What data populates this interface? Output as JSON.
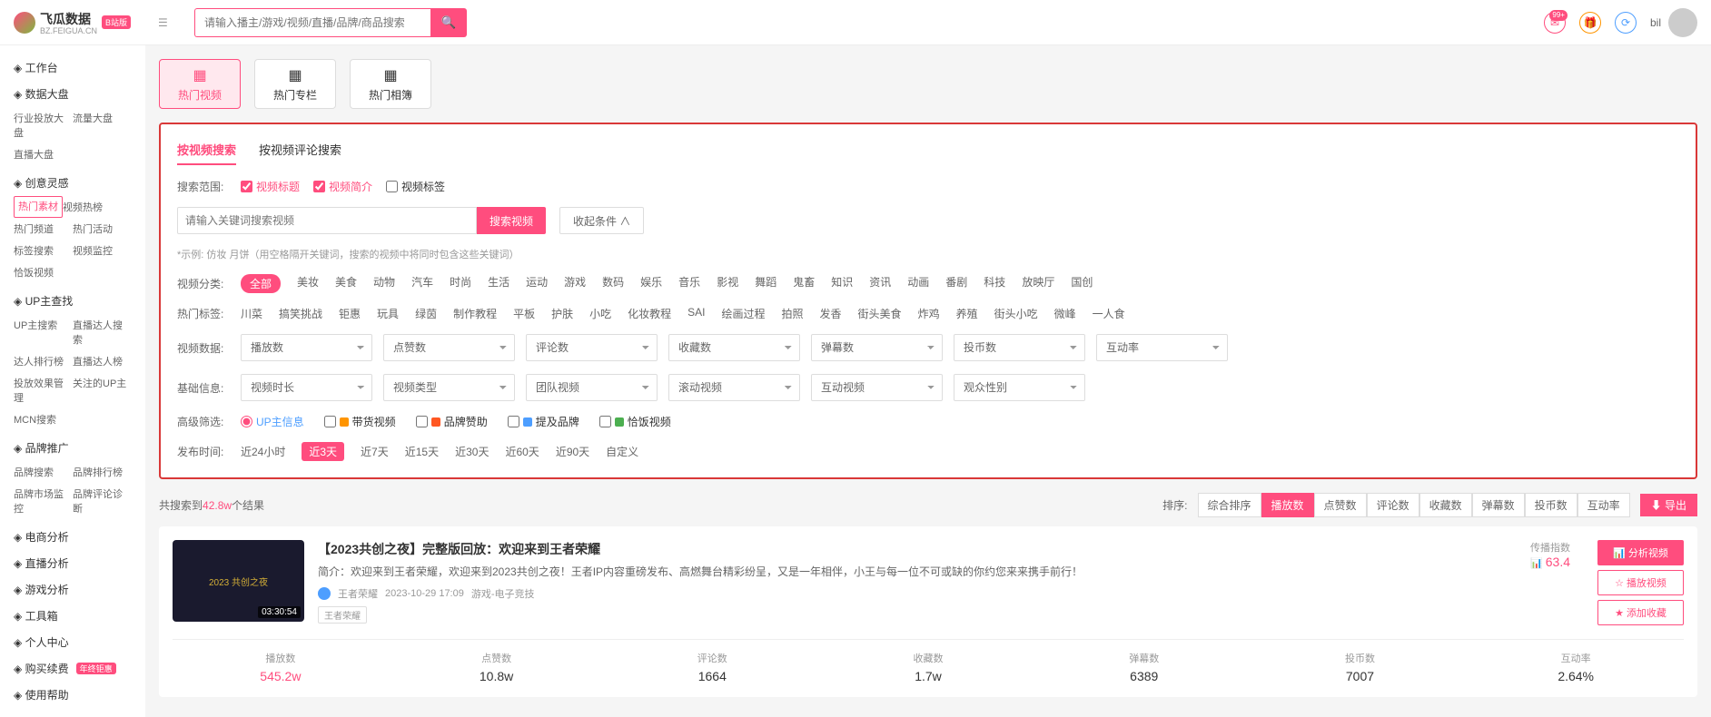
{
  "header": {
    "logo_name": "飞瓜数据",
    "logo_sub": "BZ.FEIGUA.CN",
    "logo_badge": "B站版",
    "search_placeholder": "请输入播主/游戏/视频/直播/品牌/商品搜索",
    "notif_badge": "99+",
    "username": "bil"
  },
  "sidebar": {
    "groups": [
      {
        "label": "工作台",
        "items": []
      },
      {
        "label": "数据大盘",
        "items": [
          "行业投放大盘",
          "流量大盘",
          "直播大盘"
        ]
      },
      {
        "label": "创意灵感",
        "items_special": [
          {
            "label": "热门素材",
            "active": true
          },
          {
            "label": "视频热榜"
          },
          {
            "label": "热门频道"
          },
          {
            "label": "热门活动"
          },
          {
            "label": "标签搜索"
          },
          {
            "label": "视频监控"
          },
          {
            "label": "恰饭视频"
          }
        ]
      },
      {
        "label": "UP主查找",
        "items": [
          "UP主搜索",
          "直播达人搜索",
          "达人排行榜",
          "直播达人榜",
          "投放效果管理",
          "关注的UP主",
          "MCN搜索"
        ]
      },
      {
        "label": "品牌推广",
        "items": [
          "品牌搜索",
          "品牌排行榜",
          "品牌市场监控",
          "品牌评论诊断"
        ]
      },
      {
        "label": "电商分析",
        "items": []
      },
      {
        "label": "直播分析",
        "items": []
      },
      {
        "label": "游戏分析",
        "items": []
      },
      {
        "label": "工具箱",
        "items": []
      },
      {
        "label": "个人中心",
        "items": []
      },
      {
        "label": "购买续费",
        "badge": "年终钜惠",
        "items": []
      },
      {
        "label": "使用帮助",
        "items": []
      }
    ]
  },
  "tabs": [
    {
      "label": "热门视频",
      "active": true
    },
    {
      "label": "热门专栏"
    },
    {
      "label": "热门相簿"
    }
  ],
  "sub_tabs": {
    "a": "按视频搜索",
    "b": "按视频评论搜索"
  },
  "search_scope": {
    "label": "搜索范围:",
    "opts": [
      "视频标题",
      "视频简介",
      "视频标签"
    ]
  },
  "keyword": {
    "placeholder": "请输入关键词搜索视频",
    "btn": "搜索视频",
    "collapse": "收起条件 ∧"
  },
  "hint": "*示例: 仿妆 月饼（用空格隔开关键词，搜索的视频中将同时包含这些关键词）",
  "categories": {
    "label": "视频分类:",
    "items": [
      "全部",
      "美妆",
      "美食",
      "动物",
      "汽车",
      "时尚",
      "生活",
      "运动",
      "游戏",
      "数码",
      "娱乐",
      "音乐",
      "影视",
      "舞蹈",
      "鬼畜",
      "知识",
      "资讯",
      "动画",
      "番剧",
      "科技",
      "放映厅",
      "国创"
    ]
  },
  "hot_tags": {
    "label": "热门标签:",
    "items": [
      "川菜",
      "搞笑挑战",
      "钜惠",
      "玩具",
      "绿茵",
      "制作教程",
      "平板",
      "护肤",
      "小吃",
      "化妆教程",
      "SAI",
      "绘画过程",
      "拍照",
      "发香",
      "街头美食",
      "炸鸡",
      "养殖",
      "街头小吃",
      "微峰",
      "一人食"
    ]
  },
  "data_filters": {
    "label": "视频数据:",
    "selects": [
      "播放数",
      "点赞数",
      "评论数",
      "收藏数",
      "弹幕数",
      "投币数",
      "互动率"
    ]
  },
  "base_filters": {
    "label": "基础信息:",
    "selects": [
      "视频时长",
      "视频类型",
      "团队视频",
      "滚动视频",
      "互动视频",
      "观众性别"
    ]
  },
  "adv_filters": {
    "label": "高级筛选:",
    "items": [
      {
        "label": "UP主信息",
        "type": "radio",
        "checked": true
      },
      {
        "label": "带货视频",
        "color": "#ff9500"
      },
      {
        "label": "品牌赞助",
        "color": "#ff5722"
      },
      {
        "label": "提及品牌",
        "color": "#4d9eff"
      },
      {
        "label": "恰饭视频",
        "color": "#4caf50"
      }
    ]
  },
  "time_filter": {
    "label": "发布时间:",
    "items": [
      "近24小时",
      "近3天",
      "近7天",
      "近15天",
      "近30天",
      "近60天",
      "近90天",
      "自定义"
    ],
    "active": 1
  },
  "results": {
    "prefix": "共搜索到",
    "count": "42.8w",
    "suffix": "个结果",
    "sort_label": "排序:",
    "sorts": [
      "综合排序",
      "播放数",
      "点赞数",
      "评论数",
      "收藏数",
      "弹幕数",
      "投币数",
      "互动率"
    ],
    "export": "导出"
  },
  "video": {
    "title": "【2023共创之夜】完整版回放：欢迎来到王者荣耀",
    "desc": "简介：欢迎来到王者荣耀，欢迎来到2023共创之夜！王者IP内容重磅发布、高燃舞台精彩纷呈，又是一年相伴，小王与每一位不可或缺的你约您来来携手前行！",
    "author": "王者荣耀",
    "date": "2023-10-29 17:09",
    "cat": "游戏-电子竞技",
    "tag": "王者荣耀",
    "duration": "03:30:54",
    "thumb_text": "2023 共创之夜",
    "ad_label": "传播指数",
    "ad_val": "63.4",
    "actions": {
      "analyze": "分析视频",
      "monitor": "播放视频",
      "fav": "添加收藏"
    },
    "stats": [
      {
        "label": "播放数",
        "val": "545.2w",
        "pink": true
      },
      {
        "label": "点赞数",
        "val": "10.8w"
      },
      {
        "label": "评论数",
        "val": "1664"
      },
      {
        "label": "收藏数",
        "val": "1.7w"
      },
      {
        "label": "弹幕数",
        "val": "6389"
      },
      {
        "label": "投币数",
        "val": "7007"
      },
      {
        "label": "互动率",
        "val": "2.64%"
      }
    ]
  }
}
